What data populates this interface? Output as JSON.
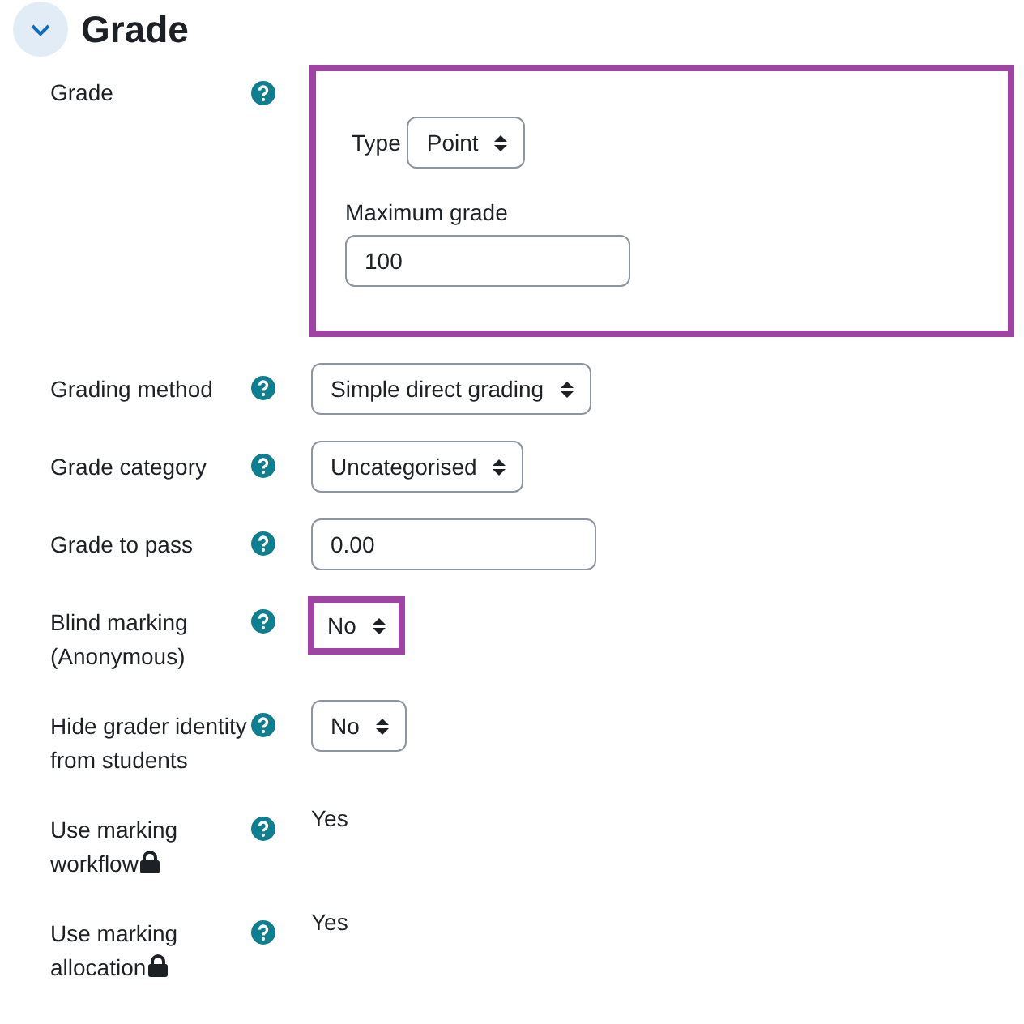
{
  "section": {
    "title": "Grade",
    "expanded": true
  },
  "rows": [
    {
      "kind": "group",
      "label": "Grade",
      "highlighted": true,
      "type_label": "Type",
      "type_value": "Point",
      "max_label": "Maximum grade",
      "max_value": "100"
    },
    {
      "kind": "select",
      "label": "Grading method",
      "value": "Simple direct grading"
    },
    {
      "kind": "select",
      "label": "Grade category",
      "value": "Uncategorised"
    },
    {
      "kind": "input",
      "label": "Grade to pass",
      "value": "0.00"
    },
    {
      "kind": "select",
      "label": "Blind marking (Anonymous)",
      "value": "No",
      "highlighted": true
    },
    {
      "kind": "select",
      "label": "Hide grader identity from students",
      "value": "No"
    },
    {
      "kind": "static",
      "label": "Use marking workflow",
      "value": "Yes",
      "locked": true
    },
    {
      "kind": "static",
      "label": "Use marking allocation",
      "value": "Yes",
      "locked": true
    }
  ]
}
